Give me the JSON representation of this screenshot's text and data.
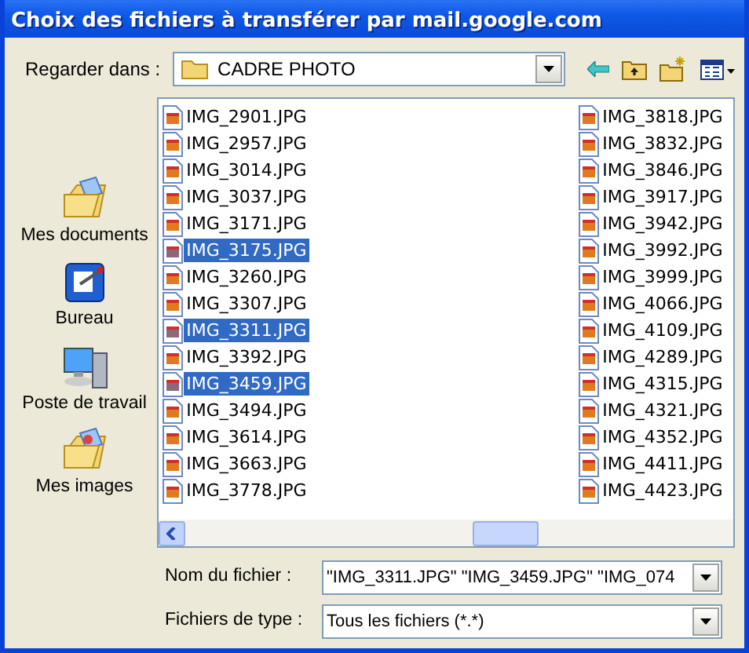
{
  "window": {
    "title": "Choix des fichiers à transférer par mail.google.com"
  },
  "look_in": {
    "label": "Regarder dans :",
    "value": "CADRE PHOTO"
  },
  "places": [
    {
      "kind": "documents",
      "label": "Mes documents"
    },
    {
      "kind": "desktop",
      "label": "Bureau"
    },
    {
      "kind": "computer",
      "label": "Poste de travail"
    },
    {
      "kind": "pictures",
      "label": "Mes images"
    }
  ],
  "file_columns": [
    [
      {
        "name": "IMG_2901.JPG",
        "selected": false
      },
      {
        "name": "IMG_2957.JPG",
        "selected": false
      },
      {
        "name": "IMG_3014.JPG",
        "selected": false
      },
      {
        "name": "IMG_3037.JPG",
        "selected": false
      },
      {
        "name": "IMG_3171.JPG",
        "selected": false
      },
      {
        "name": "IMG_3175.JPG",
        "selected": true
      },
      {
        "name": "IMG_3260.JPG",
        "selected": false
      },
      {
        "name": "IMG_3307.JPG",
        "selected": false
      },
      {
        "name": "IMG_3311.JPG",
        "selected": true
      },
      {
        "name": "IMG_3392.JPG",
        "selected": false
      },
      {
        "name": "IMG_3459.JPG",
        "selected": true
      },
      {
        "name": "IMG_3494.JPG",
        "selected": false
      },
      {
        "name": "IMG_3614.JPG",
        "selected": false
      },
      {
        "name": "IMG_3663.JPG",
        "selected": false
      },
      {
        "name": "IMG_3778.JPG",
        "selected": false
      }
    ],
    [
      {
        "name": "IMG_3818.JPG",
        "selected": false
      },
      {
        "name": "IMG_3832.JPG",
        "selected": false
      },
      {
        "name": "IMG_3846.JPG",
        "selected": false
      },
      {
        "name": "IMG_3917.JPG",
        "selected": false
      },
      {
        "name": "IMG_3942.JPG",
        "selected": false
      },
      {
        "name": "IMG_3992.JPG",
        "selected": false
      },
      {
        "name": "IMG_3999.JPG",
        "selected": false
      },
      {
        "name": "IMG_4066.JPG",
        "selected": false
      },
      {
        "name": "IMG_4109.JPG",
        "selected": false
      },
      {
        "name": "IMG_4289.JPG",
        "selected": false
      },
      {
        "name": "IMG_4315.JPG",
        "selected": false
      },
      {
        "name": "IMG_4321.JPG",
        "selected": false
      },
      {
        "name": "IMG_4352.JPG",
        "selected": false
      },
      {
        "name": "IMG_4411.JPG",
        "selected": false
      },
      {
        "name": "IMG_4423.JPG",
        "selected": false
      }
    ]
  ],
  "file_name": {
    "label": "Nom du fichier :",
    "value": "\"IMG_3311.JPG\" \"IMG_3459.JPG\" \"IMG_074"
  },
  "file_type": {
    "label": "Fichiers de type :",
    "value": "Tous les fichiers (*.*)"
  }
}
